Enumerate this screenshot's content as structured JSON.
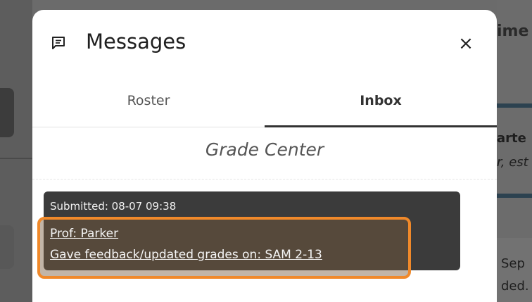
{
  "background": {
    "right_title": "ime",
    "right_text_1": "arte",
    "right_text_2": "r, est",
    "right_text_3": "Sep",
    "right_text_4": "ded."
  },
  "modal": {
    "title": "Messages",
    "close_label": "×",
    "icons": {
      "title_icon": "message-icon",
      "close_icon": "close-icon"
    }
  },
  "tabs": [
    {
      "label": "Roster",
      "active": false
    },
    {
      "label": "Inbox",
      "active": true
    }
  ],
  "inbox": {
    "section_title": "Grade Center",
    "messages": [
      {
        "submitted": "Submitted: 08-07 09:38",
        "from": "Prof: Parker",
        "body": "Gave feedback/updated grades on: SAM 2-13"
      }
    ]
  },
  "colors": {
    "highlight": "#f0892a",
    "card": "#3b3b3b",
    "active_tab_underline": "#333333"
  }
}
